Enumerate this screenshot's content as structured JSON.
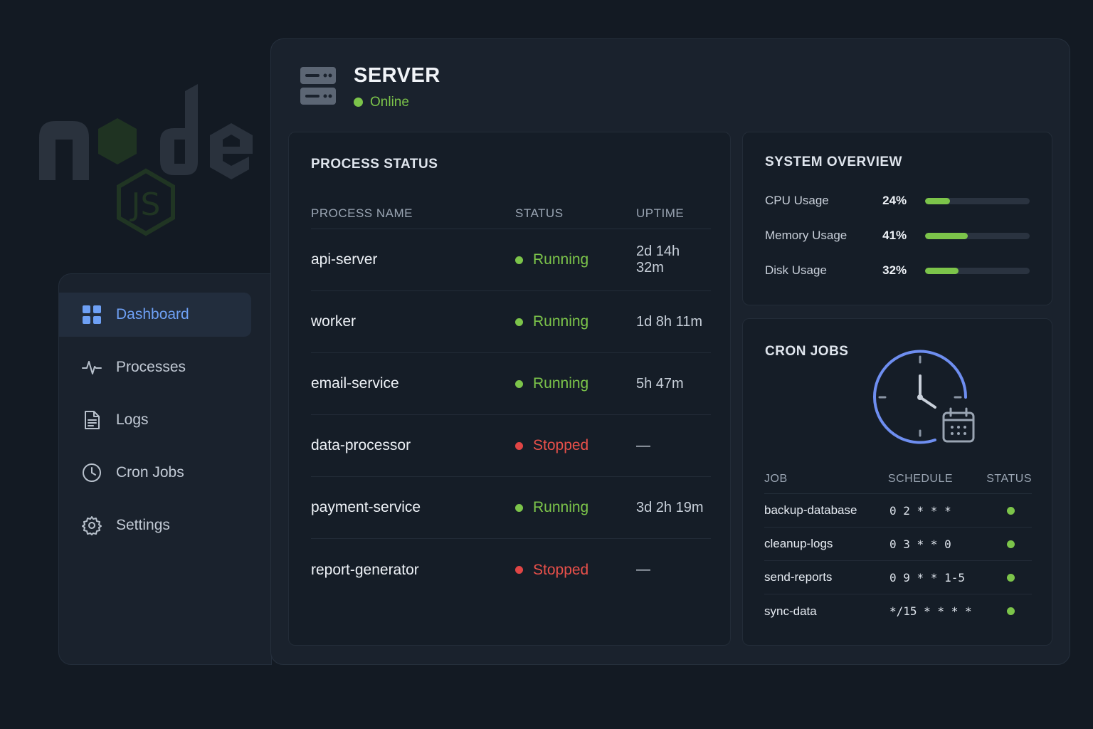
{
  "background": {
    "logo_icon": "nodejs-logo"
  },
  "sidebar": {
    "items": [
      {
        "label": "Dashboard",
        "icon": "dashboard-grid-icon",
        "active": true
      },
      {
        "label": "Processes",
        "icon": "activity-pulse-icon",
        "active": false
      },
      {
        "label": "Logs",
        "icon": "document-icon",
        "active": false
      },
      {
        "label": "Cron Jobs",
        "icon": "clock-icon",
        "active": false
      },
      {
        "label": "Settings",
        "icon": "gear-icon",
        "active": false
      }
    ]
  },
  "server": {
    "title": "SERVER",
    "status": "Online",
    "icon": "server-icon"
  },
  "process_status": {
    "title": "PROCESS STATUS",
    "columns": [
      "PROCESS NAME",
      "STATUS",
      "UPTIME"
    ],
    "rows": [
      {
        "name": "api-server",
        "status": "Running",
        "uptime": "2d 14h 32m"
      },
      {
        "name": "worker",
        "status": "Running",
        "uptime": "1d 8h 11m"
      },
      {
        "name": "email-service",
        "status": "Running",
        "uptime": "5h 47m"
      },
      {
        "name": "data-processor",
        "status": "Stopped",
        "uptime": "—"
      },
      {
        "name": "payment-service",
        "status": "Running",
        "uptime": "3d 2h 19m"
      },
      {
        "name": "report-generator",
        "status": "Stopped",
        "uptime": "—"
      }
    ]
  },
  "system_overview": {
    "title": "SYSTEM OVERVIEW",
    "metrics": [
      {
        "label": "CPU Usage",
        "value": "24%",
        "percent": 24
      },
      {
        "label": "Memory Usage",
        "value": "41%",
        "percent": 41
      },
      {
        "label": "Disk Usage",
        "value": "32%",
        "percent": 32
      }
    ]
  },
  "cron_jobs": {
    "title": "CRON JOBS",
    "illustration_icon": "clock-calendar-icon",
    "columns": [
      "JOB",
      "SCHEDULE",
      "STATUS"
    ],
    "rows": [
      {
        "job": "backup-database",
        "schedule": "0 2 * * *",
        "status": "active"
      },
      {
        "job": "cleanup-logs",
        "schedule": "0 3 * * 0",
        "status": "active"
      },
      {
        "job": "send-reports",
        "schedule": "0 9 * * 1-5",
        "status": "active"
      },
      {
        "job": "sync-data",
        "schedule": "*/15 * * * *",
        "status": "active"
      }
    ]
  },
  "colors": {
    "accent": "#6ea0f5",
    "running": "#7cc44a",
    "stopped": "#e8504a",
    "background": "#131a23",
    "panel": "#1a222d"
  }
}
